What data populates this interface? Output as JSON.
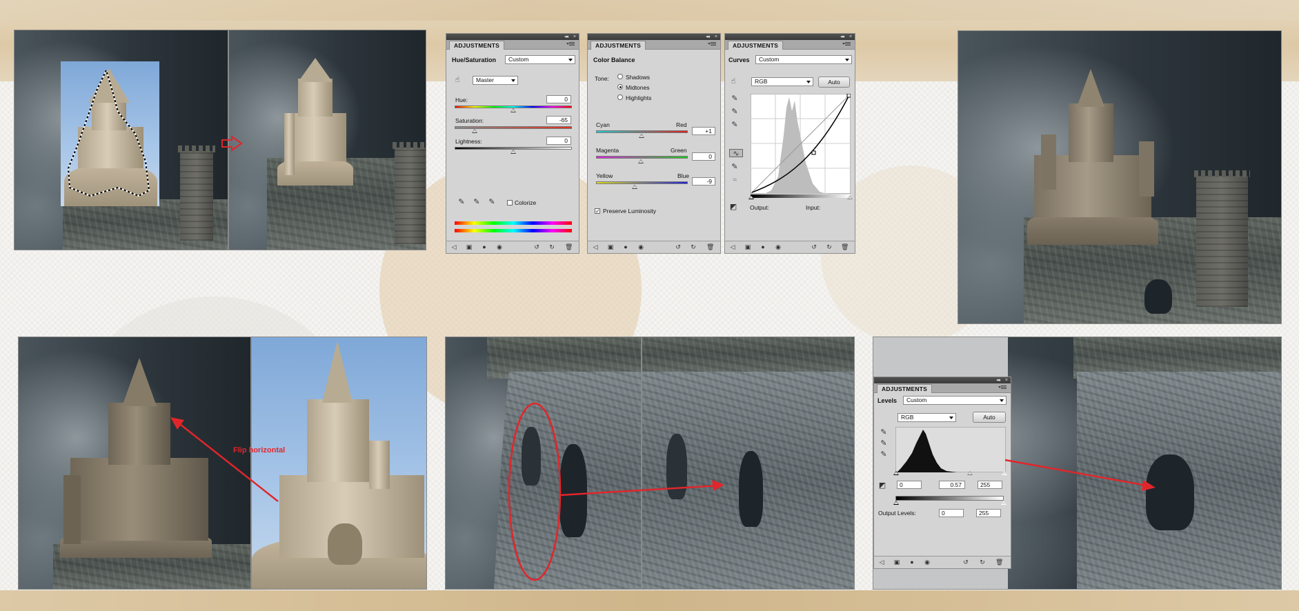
{
  "annotation": {
    "flip_label": "Flip horizontal"
  },
  "panel_huesat": {
    "tab": "ADJUSTMENTS",
    "title": "Hue/Saturation",
    "preset": "Custom",
    "channel": "Master",
    "hue_label": "Hue:",
    "hue_value": "0",
    "saturation_label": "Saturation:",
    "saturation_value": "-65",
    "lightness_label": "Lightness:",
    "lightness_value": "0",
    "colorize_label": "Colorize"
  },
  "panel_colorbalance": {
    "tab": "ADJUSTMENTS",
    "title": "Color Balance",
    "tone_label": "Tone:",
    "tones": [
      "Shadows",
      "Midtones",
      "Highlights"
    ],
    "selected_tone": "Midtones",
    "cyan": "Cyan",
    "red": "Red",
    "cyan_red_value": "+1",
    "magenta": "Magenta",
    "green": "Green",
    "magenta_green_value": "0",
    "yellow": "Yellow",
    "blue": "Blue",
    "yellow_blue_value": "-9",
    "preserve_label": "Preserve Luminosity"
  },
  "panel_curves": {
    "tab": "ADJUSTMENTS",
    "title": "Curves",
    "preset": "Custom",
    "channel": "RGB",
    "auto_label": "Auto",
    "output_label": "Output:",
    "input_label": "Input:"
  },
  "panel_levels": {
    "tab": "ADJUSTMENTS",
    "title": "Levels",
    "preset": "Custom",
    "channel": "RGB",
    "auto_label": "Auto",
    "input_black": "0",
    "input_gamma": "0.57",
    "input_white": "255",
    "output_label": "Output Levels:",
    "output_black": "0",
    "output_white": "255"
  },
  "colors": {
    "annotation_red": "#e0262b",
    "panel_gray": "#d4d4d4",
    "panel_header": "#3a3a3a"
  }
}
